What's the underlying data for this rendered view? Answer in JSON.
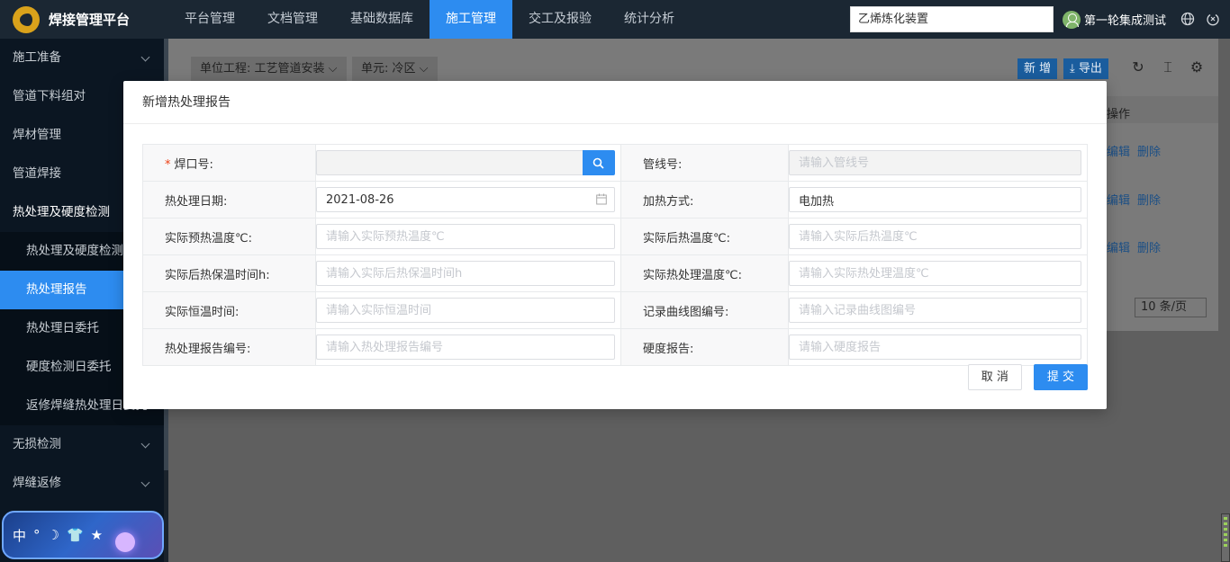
{
  "app": {
    "title": "焊接管理平台"
  },
  "topnav": {
    "items": [
      {
        "label": "平台管理"
      },
      {
        "label": "文档管理"
      },
      {
        "label": "基础数据库"
      },
      {
        "label": "施工管理"
      },
      {
        "label": "交工及报验"
      },
      {
        "label": "统计分析"
      }
    ],
    "active": "施工管理",
    "search_value": "乙烯炼化装置",
    "user_name": "第一轮集成测试"
  },
  "sidebar": {
    "items": [
      {
        "label": "施工准备"
      },
      {
        "label": "管道下料组对"
      },
      {
        "label": "焊材管理"
      },
      {
        "label": "管道焊接"
      },
      {
        "label": "热处理及硬度检测"
      }
    ],
    "sub_items": [
      {
        "label": "热处理及硬度检测总"
      },
      {
        "label": "热处理报告"
      },
      {
        "label": "热处理日委托"
      },
      {
        "label": "硬度检测日委托"
      },
      {
        "label": "返修焊缝热处理日委托"
      }
    ],
    "after_items": [
      {
        "label": "无损检测"
      },
      {
        "label": "焊缝返修"
      }
    ],
    "widget": {
      "chars": [
        "中",
        "°",
        "☽",
        "👕",
        "★"
      ]
    }
  },
  "background_page": {
    "unit_project": "单位工程: 工艺管道安装",
    "unit": "单元: 冷区",
    "add_label": "新 增",
    "export_label": "导出",
    "op_header": "操作",
    "edit_label": "编辑",
    "delete_label": "删除",
    "page_size": "10 条/页"
  },
  "modal": {
    "title": "新增热处理报告",
    "fields": {
      "weld_no": {
        "label": "焊口号:",
        "value": "",
        "placeholder": ""
      },
      "pipeline_no": {
        "label": "管线号:",
        "value": "",
        "placeholder": "请输入管线号"
      },
      "ht_date": {
        "label": "热处理日期:",
        "value": "2021-08-26"
      },
      "heating_method": {
        "label": "加热方式:",
        "value": "电加热"
      },
      "preheat_temp": {
        "label": "实际预热温度℃:",
        "placeholder": "请输入实际预热温度℃"
      },
      "postheat_temp": {
        "label": "实际后热温度℃:",
        "placeholder": "请输入实际后热温度℃"
      },
      "postheat_hold": {
        "label": "实际后热保温时间h:",
        "placeholder": "请输入实际后热保温时间h"
      },
      "ht_temp": {
        "label": "实际热处理温度℃:",
        "placeholder": "请输入实际热处理温度℃"
      },
      "hold_time": {
        "label": "实际恒温时间:",
        "placeholder": "请输入实际恒温时间"
      },
      "curve_no": {
        "label": "记录曲线图编号:",
        "placeholder": "请输入记录曲线图编号"
      },
      "report_no": {
        "label": "热处理报告编号:",
        "placeholder": "请输入热处理报告编号"
      },
      "hardness": {
        "label": "硬度报告:",
        "placeholder": "请输入硬度报告"
      }
    },
    "cancel_label": "取 消",
    "submit_label": "提 交"
  },
  "colors": {
    "primary": "#2d8cf0",
    "topbar": "#1b2733",
    "sidebar": "#0b1622"
  }
}
